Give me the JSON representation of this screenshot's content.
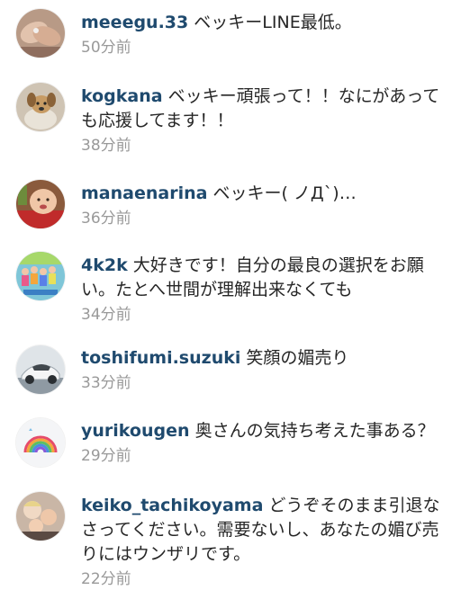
{
  "comments": [
    {
      "username": "meeegu.33",
      "text": "ベッキーLINE最低。",
      "time": "50分前",
      "avatar": "hands-photo-icon"
    },
    {
      "username": "kogkana",
      "text": "ベッキー頑張って！！なにがあっても応援してます！！",
      "time": "38分前",
      "avatar": "dog-photo-icon"
    },
    {
      "username": "manaenarina",
      "text": "ベッキー( ノД`)…",
      "time": "36分前",
      "avatar": "baby-photo-icon"
    },
    {
      "username": "4k2k",
      "text": "大好きです！自分の最良の選択をお願い。たとへ世間が理解出来なくても",
      "time": "34分前",
      "avatar": "group-poster-icon"
    },
    {
      "username": "toshifumi.suzuki",
      "text": "笑顔の媚売り",
      "time": "33分前",
      "avatar": "car-photo-icon"
    },
    {
      "username": "yurikougen",
      "text": "奥さんの気持ち考えた事ある？",
      "time": "29分前",
      "avatar": "rainbow-drawing-icon"
    },
    {
      "username": "keiko_tachikoyama",
      "text": "どうぞそのまま引退なさってください。需要ないし、あなたの媚び売りにはウンザリです。",
      "time": "22分前",
      "avatar": "family-photo-icon"
    }
  ],
  "colors": {
    "username": "#1f4a6e",
    "timestamp": "#999999",
    "text": "#262626",
    "background": "#ffffff"
  }
}
